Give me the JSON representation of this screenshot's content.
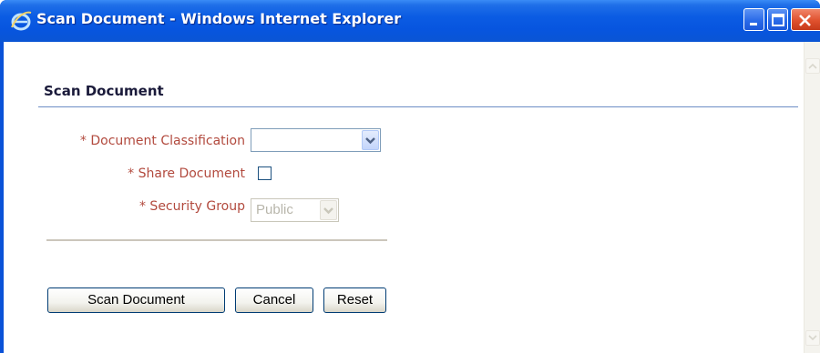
{
  "window": {
    "title": "Scan Document - Windows Internet Explorer"
  },
  "form": {
    "heading": "Scan Document",
    "fields": {
      "classification_label": "* Document Classification",
      "classification_value": "",
      "share_label": "* Share Document",
      "share_checked": false,
      "security_label": "* Security Group",
      "security_value": "Public"
    },
    "buttons": {
      "scan": "Scan Document",
      "cancel": "Cancel",
      "reset": "Reset"
    }
  },
  "colors": {
    "titlebar": "#0b5ce3",
    "label_required": "#b24a3e",
    "section_rule": "#6d8ec6"
  },
  "icons": {
    "app": "ie-icon",
    "minimize": "minimize-icon",
    "maximize": "maximize-icon",
    "close": "close-icon",
    "dropdown": "chevron-down-icon"
  }
}
